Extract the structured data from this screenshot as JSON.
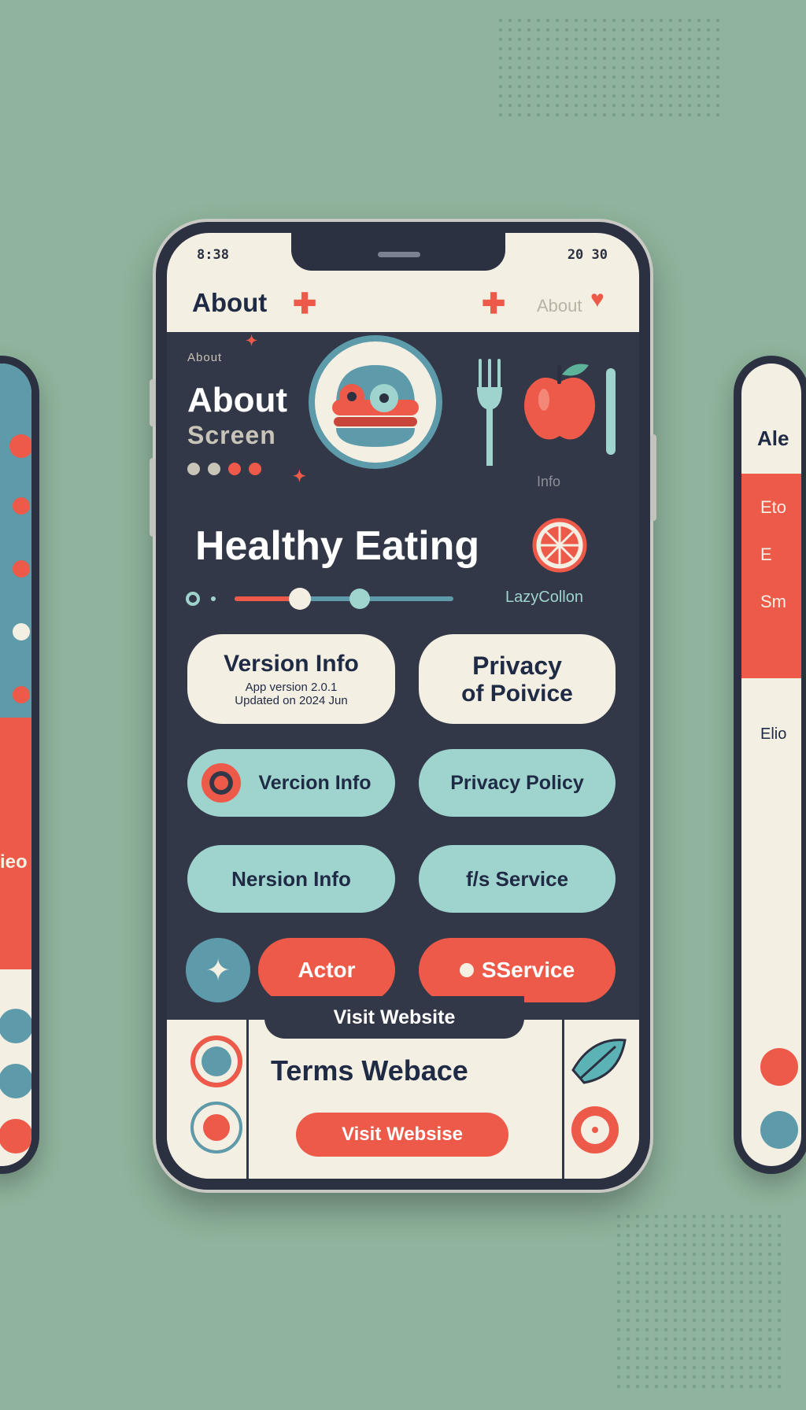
{
  "colors": {
    "background": "#8fb39c",
    "phone": "#2c3142",
    "cream": "#f4efe3",
    "accent_red": "#ee5a4a",
    "accent_teal": "#9fd3cd",
    "accent_blue": "#5d9bab"
  },
  "status_bar": {
    "time": "8:38",
    "right": "20 30"
  },
  "header": {
    "title": "About",
    "right_label": "About"
  },
  "hero": {
    "tiny_label": "About",
    "title_line1": "About",
    "title_line2": "Screen",
    "info_label": "Info",
    "badge_icon": "burger-icon",
    "icons": [
      "fork-icon",
      "apple-icon",
      "knife-icon"
    ]
  },
  "app": {
    "name": "Healthy Eating",
    "author": "LazyCollon",
    "slider_level": 0.3
  },
  "cards": {
    "version_info": {
      "title": "Version Info",
      "line1": "App version 2.0.1",
      "line2": "Updated on 2024 Jun"
    },
    "privacy": {
      "line1": "Privacy",
      "line2": "of Poivice"
    }
  },
  "buttons": {
    "version_info_1": "Vercion Info",
    "privacy_policy": "Privacy Policy",
    "version_info_2": "Nersion Info",
    "terms_service": "f/s Service",
    "actor": "Actor",
    "service": "SService"
  },
  "footer": {
    "tab_label": "Visit Website",
    "terms_title": "Terms Webace",
    "visit_button": "Visit Websise"
  },
  "side_right": {
    "title": "Ale",
    "items": [
      "Eto",
      "E",
      "Sm",
      "Elio"
    ]
  },
  "side_left": {
    "items": [
      "ieo"
    ]
  }
}
